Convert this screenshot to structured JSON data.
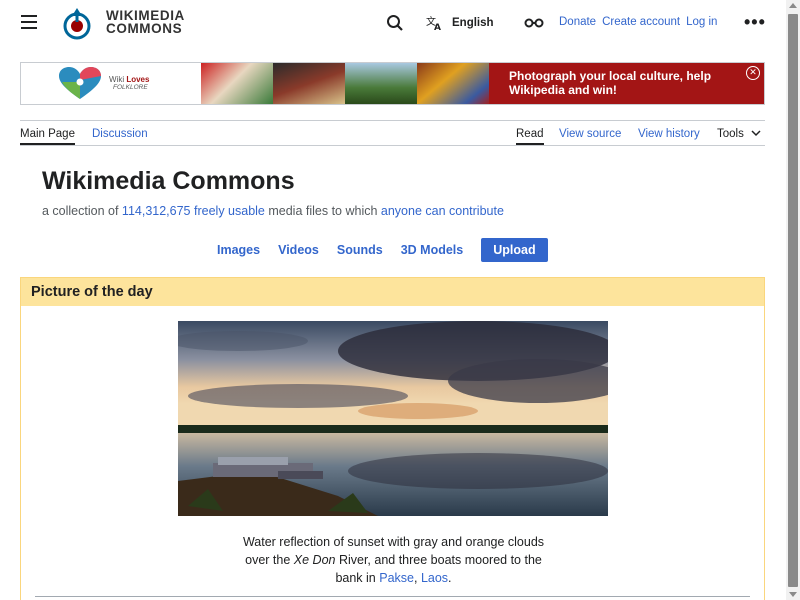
{
  "header": {
    "logo_line1": "WIKIMEDIA",
    "logo_line2": "COMMONS",
    "language": "English",
    "links": [
      "Donate",
      "Create account",
      "Log in"
    ],
    "more_icon": "ellipsis-icon"
  },
  "banner": {
    "logo_line1": "Wiki ",
    "logo_line1_bold": "Loves",
    "logo_line2": "FOLKLORE",
    "cta_line1": "Photograph your local culture, help",
    "cta_line2": "Wikipedia and win!"
  },
  "tabs": {
    "main_page": "Main Page",
    "discussion": "Discussion",
    "read": "Read",
    "view_source": "View source",
    "view_history": "View history",
    "tools": "Tools"
  },
  "page": {
    "title": "Wikimedia Commons",
    "subtitle_pre": "a collection of ",
    "count": "114,312,675",
    "subtitle_mid1": " ",
    "freely_usable": "freely usable",
    "subtitle_mid2": " media files to which ",
    "anyone": "anyone can contribute"
  },
  "media_nav": {
    "images": "Images",
    "videos": "Videos",
    "sounds": "Sounds",
    "models": "3D Models",
    "upload": "Upload"
  },
  "potd": {
    "heading": "Picture of the day",
    "caption_1": "Water reflection of sunset with gray and orange clouds",
    "caption_2a": "over the ",
    "caption_2i": "Xe Don",
    "caption_2b": " River, and three boats moored to the",
    "caption_3a": "bank in ",
    "pakse": "Pakse",
    "comma": ", ",
    "laos": "Laos",
    "period": "."
  },
  "colors": {
    "link": "#3366cc",
    "potd_header_bg": "#fde49c",
    "banner_red": "#a31515"
  }
}
